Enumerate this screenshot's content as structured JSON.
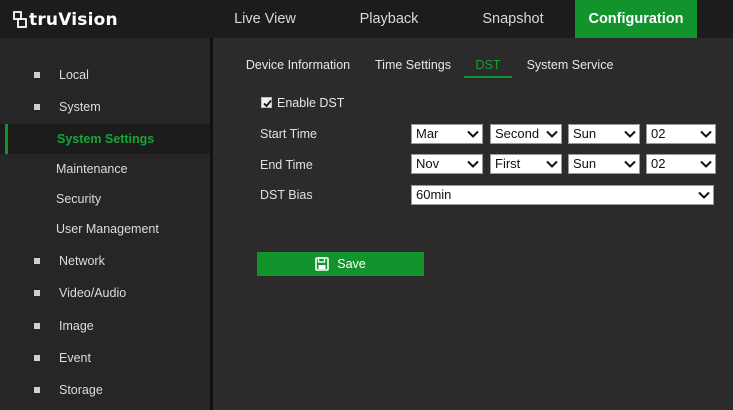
{
  "brand": {
    "name": "truVision"
  },
  "topnav": {
    "tabs": [
      {
        "label": "Live View"
      },
      {
        "label": "Playback"
      },
      {
        "label": "Snapshot"
      },
      {
        "label": "Configuration",
        "active": true
      }
    ]
  },
  "sidebar": {
    "items": [
      {
        "label": "Local"
      },
      {
        "label": "System"
      },
      {
        "label": "System Settings",
        "active": true
      },
      {
        "label": "Maintenance"
      },
      {
        "label": "Security"
      },
      {
        "label": "User Management"
      },
      {
        "label": "Network"
      },
      {
        "label": "Video/Audio"
      },
      {
        "label": "Image"
      },
      {
        "label": "Event"
      },
      {
        "label": "Storage"
      }
    ]
  },
  "subtabs": [
    {
      "label": "Device Information"
    },
    {
      "label": "Time Settings"
    },
    {
      "label": "DST",
      "active": true
    },
    {
      "label": "System Service"
    }
  ],
  "form": {
    "enable_dst": {
      "label": "Enable DST",
      "checked": true
    },
    "start_time": {
      "label": "Start Time",
      "month": "Mar",
      "week": "Second",
      "day": "Sun",
      "hour": "02"
    },
    "end_time": {
      "label": "End Time",
      "month": "Nov",
      "week": "First",
      "day": "Sun",
      "hour": "02"
    },
    "dst_bias": {
      "label": "DST Bias",
      "value": "60min"
    }
  },
  "save": {
    "label": "Save"
  },
  "colors": {
    "accent": "#12932c",
    "background": "#2b2b2b",
    "topbar": "#1c1c1c"
  }
}
